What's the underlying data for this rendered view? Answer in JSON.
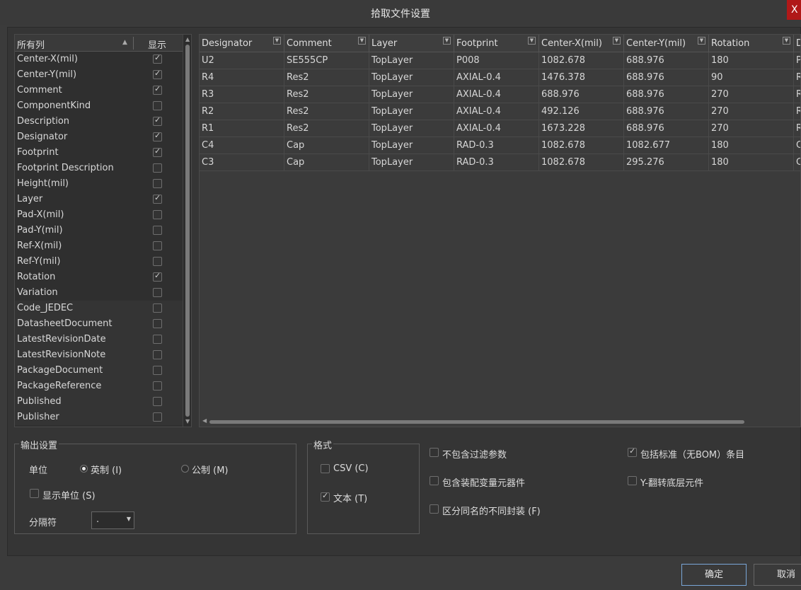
{
  "window": {
    "title": "拾取文件设置",
    "close_glyph": "X"
  },
  "columns_list": {
    "header": {
      "all_columns": "所有列",
      "show": "显示",
      "sort_glyph": "▲"
    },
    "items": [
      {
        "label": "Center-X(mil)",
        "checked": true
      },
      {
        "label": "Center-Y(mil)",
        "checked": true
      },
      {
        "label": "Comment",
        "checked": true
      },
      {
        "label": "ComponentKind",
        "checked": false
      },
      {
        "label": "Description",
        "checked": true
      },
      {
        "label": "Designator",
        "checked": true
      },
      {
        "label": "Footprint",
        "checked": true
      },
      {
        "label": "Footprint Description",
        "checked": false
      },
      {
        "label": "Height(mil)",
        "checked": false
      },
      {
        "label": "Layer",
        "checked": true
      },
      {
        "label": "Pad-X(mil)",
        "checked": false
      },
      {
        "label": "Pad-Y(mil)",
        "checked": false
      },
      {
        "label": "Ref-X(mil)",
        "checked": false
      },
      {
        "label": "Ref-Y(mil)",
        "checked": false
      },
      {
        "label": "Rotation",
        "checked": true
      },
      {
        "label": "Variation",
        "checked": false
      },
      {
        "label": "Code_JEDEC",
        "checked": false
      },
      {
        "label": "DatasheetDocument",
        "checked": false
      },
      {
        "label": "LatestRevisionDate",
        "checked": false
      },
      {
        "label": "LatestRevisionNote",
        "checked": false
      },
      {
        "label": "PackageDocument",
        "checked": false
      },
      {
        "label": "PackageReference",
        "checked": false
      },
      {
        "label": "Published",
        "checked": false
      },
      {
        "label": "Publisher",
        "checked": false
      }
    ]
  },
  "grid": {
    "headers": [
      "Designator",
      "Comment",
      "Layer",
      "Footprint",
      "Center-X(mil)",
      "Center-Y(mil)",
      "Rotation",
      "D"
    ],
    "rows": [
      [
        "U2",
        "SE555CP",
        "TopLayer",
        "P008",
        "1082.678",
        "688.976",
        "180",
        "P"
      ],
      [
        "R4",
        "Res2",
        "TopLayer",
        "AXIAL-0.4",
        "1476.378",
        "688.976",
        "90",
        "R"
      ],
      [
        "R3",
        "Res2",
        "TopLayer",
        "AXIAL-0.4",
        "688.976",
        "688.976",
        "270",
        "R"
      ],
      [
        "R2",
        "Res2",
        "TopLayer",
        "AXIAL-0.4",
        "492.126",
        "688.976",
        "270",
        "R"
      ],
      [
        "R1",
        "Res2",
        "TopLayer",
        "AXIAL-0.4",
        "1673.228",
        "688.976",
        "270",
        "R"
      ],
      [
        "C4",
        "Cap",
        "TopLayer",
        "RAD-0.3",
        "1082.678",
        "1082.677",
        "180",
        "C"
      ],
      [
        "C3",
        "Cap",
        "TopLayer",
        "RAD-0.3",
        "1082.678",
        "295.276",
        "180",
        "C"
      ]
    ]
  },
  "output_settings": {
    "title": "输出设置",
    "unit_label": "单位",
    "imperial": "英制 (I)",
    "metric": "公制 (M)",
    "unit_selected": "imperial",
    "show_units": "显示单位 (S)",
    "show_units_checked": false,
    "separator_label": "分隔符",
    "separator_value": "."
  },
  "format": {
    "title": "格式",
    "csv": "CSV (C)",
    "csv_checked": false,
    "text": "文本 (T)",
    "text_checked": true
  },
  "options": {
    "exclude_filter": "不包含过滤参数",
    "exclude_filter_checked": false,
    "include_assembly_variants": "包含装配变量元器件",
    "include_assembly_variants_checked": false,
    "distinguish_footprints": "区分同名的不同封装 (F)",
    "distinguish_footprints_checked": false,
    "include_standard": "包括标准（无BOM）条目",
    "include_standard_checked": true,
    "y_flip": "Y-翻转底层元件",
    "y_flip_checked": false
  },
  "buttons": {
    "ok": "确定",
    "cancel": "取消"
  }
}
